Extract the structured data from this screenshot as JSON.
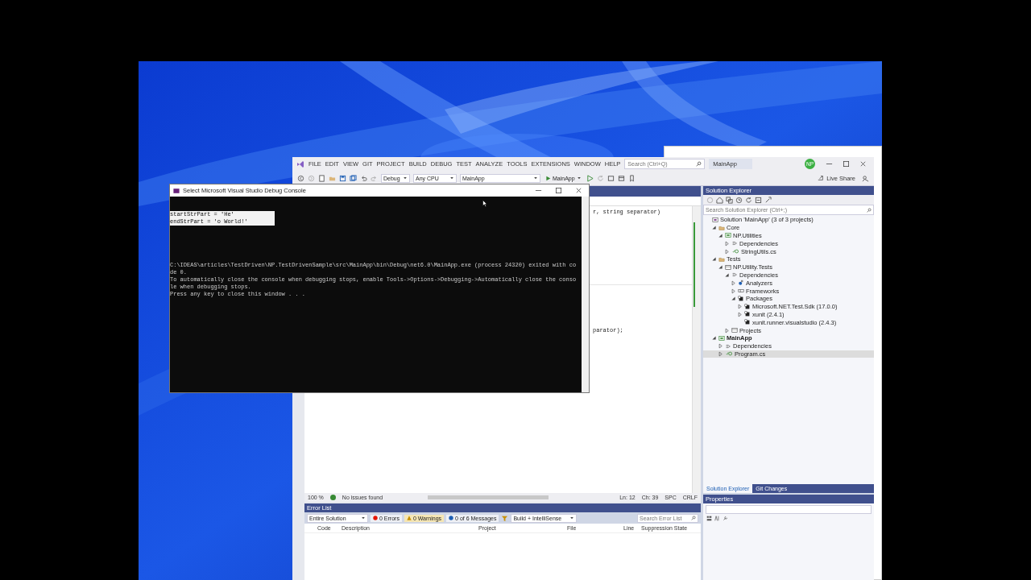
{
  "vs": {
    "menu": [
      "FILE",
      "EDIT",
      "VIEW",
      "GIT",
      "PROJECT",
      "BUILD",
      "DEBUG",
      "TEST",
      "ANALYZE",
      "TOOLS",
      "EXTENSIONS",
      "WINDOW",
      "HELP"
    ],
    "search_placeholder": "Search (Ctrl+Q)",
    "solution_name": "MainApp",
    "avatar": "NP",
    "live_share": "Live Share",
    "toolbar": {
      "configuration": "Debug",
      "platform": "Any CPU",
      "startup": "MainApp",
      "run": "MainApp"
    },
    "editor": {
      "code_fragments": [
        "r, string separator)",
        "parator);"
      ]
    },
    "status": {
      "zoom": "100 %",
      "issues": "No issues found",
      "line": "Ln: 12",
      "column": "Ch: 39",
      "spacing": "SPC",
      "line_ending": "CRLF"
    },
    "error_list": {
      "title": "Error List",
      "scope": "Entire Solution",
      "errors": "0 Errors",
      "warnings": "0 Warnings",
      "messages": "0 of 6 Messages",
      "source": "Build + IntelliSense",
      "search_placeholder": "Search Error List",
      "columns": [
        "Code",
        "Description",
        "Project",
        "File",
        "Line",
        "Suppression State"
      ]
    },
    "solution_explorer": {
      "title": "Solution Explorer",
      "search_placeholder": "Search Solution Explorer (Ctrl+;)",
      "tree": [
        {
          "label": "Solution 'MainApp' (3 of 3 projects)",
          "kind": "solution",
          "selected": false,
          "startup": false,
          "children": [
            {
              "label": "Core",
              "kind": "folder",
              "expanded": true,
              "selected": false,
              "startup": false,
              "children": [
                {
                  "label": "NP.Utilities",
                  "kind": "project",
                  "expanded": true,
                  "selected": false,
                  "startup": false,
                  "children": [
                    {
                      "label": "Dependencies",
                      "kind": "dependencies",
                      "expanded": false,
                      "selected": false,
                      "startup": false
                    },
                    {
                      "label": "StringUtils.cs",
                      "kind": "csfile",
                      "expanded": false,
                      "selected": false,
                      "startup": false
                    }
                  ]
                }
              ]
            },
            {
              "label": "Tests",
              "kind": "folder",
              "expanded": true,
              "selected": false,
              "startup": false,
              "children": [
                {
                  "label": "NP.Utility.Tests",
                  "kind": "test-project",
                  "expanded": true,
                  "selected": false,
                  "startup": false,
                  "children": [
                    {
                      "label": "Dependencies",
                      "kind": "dependencies",
                      "expanded": true,
                      "selected": false,
                      "startup": false,
                      "children": [
                        {
                          "label": "Analyzers",
                          "kind": "analyzers",
                          "expanded": false,
                          "selected": false,
                          "startup": false
                        },
                        {
                          "label": "Frameworks",
                          "kind": "frameworks",
                          "expanded": false,
                          "selected": false,
                          "startup": false
                        },
                        {
                          "label": "Packages",
                          "kind": "packages",
                          "expanded": true,
                          "selected": false,
                          "startup": false,
                          "children": [
                            {
                              "label": "Microsoft.NET.Test.Sdk (17.0.0)",
                              "kind": "package",
                              "expanded": false,
                              "selected": false,
                              "startup": false
                            },
                            {
                              "label": "xunit (2.4.1)",
                              "kind": "package",
                              "expanded": false,
                              "selected": false,
                              "startup": false
                            },
                            {
                              "label": "xunit.runner.visualstudio (2.4.3)",
                              "kind": "package",
                              "selected": false,
                              "startup": false
                            }
                          ]
                        }
                      ]
                    },
                    {
                      "label": "Projects",
                      "kind": "projects",
                      "expanded": false,
                      "selected": false,
                      "startup": false
                    }
                  ]
                }
              ]
            },
            {
              "label": "MainApp",
              "kind": "project",
              "expanded": true,
              "selected": false,
              "startup": true,
              "children": [
                {
                  "label": "Dependencies",
                  "kind": "dependencies",
                  "expanded": false,
                  "selected": false,
                  "startup": false
                },
                {
                  "label": "Program.cs",
                  "kind": "csfile",
                  "expanded": false,
                  "selected": true,
                  "startup": false
                }
              ]
            }
          ]
        }
      ],
      "tabs": [
        {
          "label": "Solution Explorer",
          "selected": true
        },
        {
          "label": "Git Changes",
          "selected": false
        }
      ]
    },
    "properties": {
      "title": "Properties"
    }
  },
  "console": {
    "title": "Select Microsoft Visual Studio Debug Console",
    "selected_lines": [
      "startStrPart = 'He'",
      "endStrPart = 'o World!'"
    ],
    "lines": [
      "C:\\IDEAS\\articles\\TestDriven\\NP.TestDrivenSample\\src\\MainApp\\bin\\Debug\\net6.0\\MainApp.exe (process 24320) exited with co",
      "de 0.",
      "To automatically close the console when debugging stops, enable Tools->Options->Debugging->Automatically close the conso",
      "le when debugging stops.",
      "Press any key to close this window . . ."
    ]
  }
}
